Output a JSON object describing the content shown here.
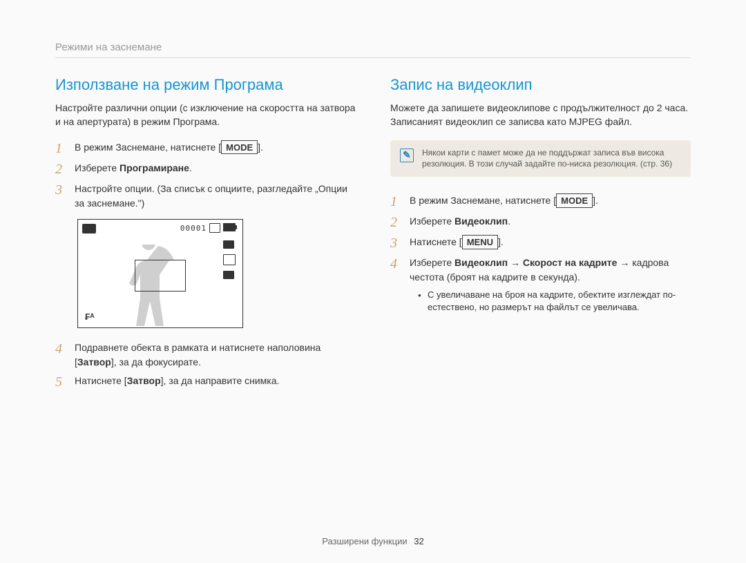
{
  "section_header": "Режими на заснемане",
  "left": {
    "heading": "Използване на режим Програма",
    "intro": "Настройте различни опции (с изключение на скоростта на затвора и на апертурата) в режим Програма.",
    "steps": [
      {
        "num": "1",
        "pre": "В режим Заснемане, натиснете [",
        "frame": "MODE",
        "post": "]."
      },
      {
        "num": "2",
        "pre": "Изберете ",
        "bold": "Програмиране",
        "post": "."
      },
      {
        "num": "3",
        "pre": "Настройте опции. (За списък с опциите, разгледайте „Опции за заснемане.\")"
      },
      {
        "num": "4",
        "pre": "Подравнете обекта в рамката и натиснете наполовина [",
        "bold": "Затвор",
        "post": "], за да фокусирате."
      },
      {
        "num": "5",
        "pre": "Натиснете [",
        "bold": "Затвор",
        "post": "], за да направите снимка."
      }
    ],
    "preview_counter": "00001",
    "preview_flash": "₣ᴬ"
  },
  "right": {
    "heading": "Запис на видеоклип",
    "intro": "Можете да запишете видеоклипове с продължителност до 2 часа. Записаният видеоклип се записва като MJPEG файл.",
    "note": "Някои карти с памет може да не поддържат записа във висока резолюция. В този случай задайте по-ниска резолюция. (стр. 36)",
    "steps": [
      {
        "num": "1",
        "pre": "В режим Заснемане, натиснете [",
        "frame": "MODE",
        "post": "]."
      },
      {
        "num": "2",
        "pre": "Изберете ",
        "bold": "Видеоклип",
        "post": "."
      },
      {
        "num": "3",
        "pre": "Натиснете [",
        "frame": "MENU",
        "post": "]."
      },
      {
        "num": "4",
        "pre": "Изберете ",
        "bold": "Видеоклип",
        "arrow": " → ",
        "bold2": "Скорост на кадрите",
        "arrow2": " → ",
        "post": "кадрова честота (броят на кадрите в секунда)."
      }
    ],
    "bullet": "С увеличаване на броя на кадрите, обектите изглеждат по-естествено, но размерът на файлът се увеличава."
  },
  "footer_label": "Разширени функции",
  "footer_page": "32"
}
